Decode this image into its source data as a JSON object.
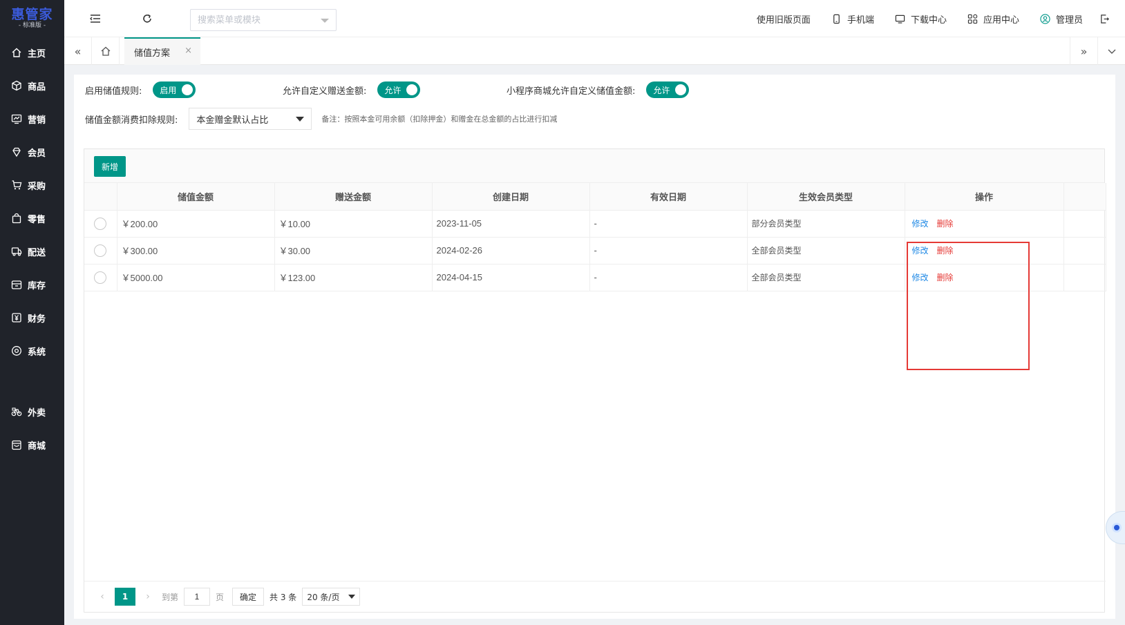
{
  "app": {
    "logo_title": "惠管家",
    "logo_sub": "- 标准版 -"
  },
  "sidebar": {
    "items": [
      {
        "label": "主页",
        "icon": "home-icon"
      },
      {
        "label": "商品",
        "icon": "box-icon"
      },
      {
        "label": "营销",
        "icon": "chart-icon"
      },
      {
        "label": "会员",
        "icon": "diamond-icon"
      },
      {
        "label": "采购",
        "icon": "cart-icon"
      },
      {
        "label": "零售",
        "icon": "bag-icon"
      },
      {
        "label": "配送",
        "icon": "truck-icon"
      },
      {
        "label": "库存",
        "icon": "warehouse-icon"
      },
      {
        "label": "财务",
        "icon": "yuan-icon"
      },
      {
        "label": "系统",
        "icon": "settings-icon"
      },
      {
        "label": "外卖",
        "icon": "bike-icon"
      },
      {
        "label": "商城",
        "icon": "store-icon"
      }
    ]
  },
  "topbar": {
    "search_placeholder": "搜索菜单或模块",
    "old_page": "使用旧版页面",
    "mobile": "手机端",
    "download": "下载中心",
    "apps": "应用中心",
    "user": "管理员"
  },
  "tabs": {
    "active_label": "储值方案",
    "close_symbol": "×",
    "prev_symbol": "«",
    "next_symbol": "»"
  },
  "settings": {
    "enable_rule_label": "启用储值规则:",
    "enable_rule_value": "启用",
    "custom_gift_label": "允许自定义赠送金额:",
    "custom_gift_value": "允许",
    "mini_custom_label": "小程序商城允许自定义储值金额:",
    "mini_custom_value": "允许",
    "deduct_rule_label": "储值金额消费扣除规则:",
    "deduct_rule_value": "本金赠金默认占比",
    "deduct_note": "备注：按照本金可用余额（扣除押金）和赠金在总金额的占比进行扣减"
  },
  "toolbar": {
    "add_label": "新增"
  },
  "table": {
    "headers": [
      "储值金额",
      "赠送金额",
      "创建日期",
      "有效日期",
      "生效会员类型",
      "操作"
    ],
    "rows": [
      {
        "amount": "￥200.00",
        "gift": "￥10.00",
        "created": "2023-11-05",
        "valid": "-",
        "member_type": "部分会员类型",
        "edit": "修改",
        "delete": "删除"
      },
      {
        "amount": "￥300.00",
        "gift": "￥30.00",
        "created": "2024-02-26",
        "valid": "-",
        "member_type": "全部会员类型",
        "edit": "修改",
        "delete": "删除"
      },
      {
        "amount": "￥5000.00",
        "gift": "￥123.00",
        "created": "2024-04-15",
        "valid": "-",
        "member_type": "全部会员类型",
        "edit": "修改",
        "delete": "删除"
      }
    ]
  },
  "pager": {
    "current_page": "1",
    "goto_label": "到第",
    "goto_value": "1",
    "page_unit": "页",
    "confirm": "确定",
    "total": "共 3 条",
    "page_size": "20 条/页"
  },
  "colors": {
    "primary": "#009688",
    "sidebar_bg": "#20232a",
    "edit_link": "#1e88e5",
    "delete_link": "#e53935",
    "highlight": "#e53935"
  }
}
